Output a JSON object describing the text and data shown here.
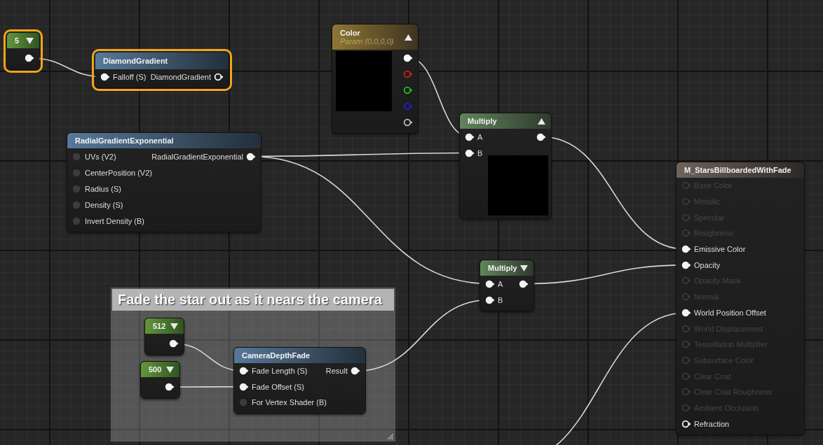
{
  "graph": {
    "nodes": [
      {
        "kind": "constant",
        "title": "5",
        "selected": true,
        "expanded": false,
        "outputs": [
          {
            "connected": true
          }
        ]
      },
      {
        "kind": "function",
        "title": "DiamondGradient",
        "selected": true,
        "inputs": [
          {
            "label": "Falloff (S)",
            "connected": true
          }
        ],
        "outputs": [
          {
            "label": "DiamondGradient",
            "connected": false
          }
        ]
      },
      {
        "kind": "parameter",
        "title": "Color",
        "subtitle": "Param (0,0,0,0)",
        "selected": false,
        "expanded": true,
        "outputs": [
          {
            "connected": true,
            "color": "#ffffff"
          },
          {
            "connected": false,
            "color": "#d02020"
          },
          {
            "connected": false,
            "color": "#20c020"
          },
          {
            "connected": false,
            "color": "#2020d0"
          },
          {
            "connected": false,
            "color": "#bbbbbb"
          }
        ]
      },
      {
        "kind": "function",
        "title": "RadialGradientExponential",
        "selected": false,
        "inputs": [
          {
            "label": "UVs (V2)",
            "connected": false
          },
          {
            "label": "CenterPosition (V2)",
            "connected": false
          },
          {
            "label": "Radius (S)",
            "connected": false
          },
          {
            "label": "Density (S)",
            "connected": false
          },
          {
            "label": "Invert Density (B)",
            "connected": false
          }
        ],
        "outputs": [
          {
            "label": "RadialGradientExponential",
            "connected": true
          }
        ]
      },
      {
        "kind": "math",
        "title": "Multiply",
        "selected": false,
        "expanded": true,
        "inputs": [
          {
            "label": "A",
            "connected": true
          },
          {
            "label": "B",
            "connected": true
          }
        ],
        "outputs": [
          {
            "connected": true
          }
        ]
      },
      {
        "kind": "result",
        "title": "M_StarsBillboardedWithFade",
        "selected": false,
        "inputs": [
          {
            "label": "Base Color",
            "connected": false,
            "disabled": true
          },
          {
            "label": "Metallic",
            "connected": false,
            "disabled": true
          },
          {
            "label": "Specular",
            "connected": false,
            "disabled": true
          },
          {
            "label": "Roughness",
            "connected": false,
            "disabled": true
          },
          {
            "label": "Emissive Color",
            "connected": true,
            "disabled": false
          },
          {
            "label": "Opacity",
            "connected": true,
            "disabled": false
          },
          {
            "label": "Opacity Mask",
            "connected": false,
            "disabled": true
          },
          {
            "label": "Normal",
            "connected": false,
            "disabled": true
          },
          {
            "label": "World Position Offset",
            "connected": true,
            "disabled": false
          },
          {
            "label": "World Displacement",
            "connected": false,
            "disabled": true
          },
          {
            "label": "Tessellation Multiplier",
            "connected": false,
            "disabled": true
          },
          {
            "label": "Subsurface Color",
            "connected": false,
            "disabled": true
          },
          {
            "label": "Clear Coat",
            "connected": false,
            "disabled": true
          },
          {
            "label": "Clear Coat Roughness",
            "connected": false,
            "disabled": true
          },
          {
            "label": "Ambient Occlusion",
            "connected": false,
            "disabled": true
          },
          {
            "label": "Refraction",
            "connected": false,
            "disabled": false
          }
        ]
      },
      {
        "kind": "math",
        "title": "Multiply",
        "selected": false,
        "expanded": false,
        "inputs": [
          {
            "label": "A",
            "connected": true
          },
          {
            "label": "B",
            "connected": true
          }
        ],
        "outputs": [
          {
            "connected": true
          }
        ]
      }
    ],
    "comment": {
      "title": "Fade the star out as it nears the camera",
      "nodes": [
        {
          "kind": "constant",
          "title": "512",
          "selected": false,
          "expanded": false,
          "outputs": [
            {
              "connected": true
            }
          ]
        },
        {
          "kind": "constant",
          "title": "500",
          "selected": false,
          "expanded": false,
          "outputs": [
            {
              "connected": true
            }
          ]
        },
        {
          "kind": "function",
          "title": "CameraDepthFade",
          "selected": false,
          "inputs": [
            {
              "label": "Fade Length (S)",
              "connected": true
            },
            {
              "label": "Fade Offset (S)",
              "connected": true
            },
            {
              "label": "For Vertex Shader (B)",
              "connected": false
            }
          ],
          "outputs": [
            {
              "label": "Result",
              "connected": true
            }
          ]
        }
      ]
    }
  }
}
